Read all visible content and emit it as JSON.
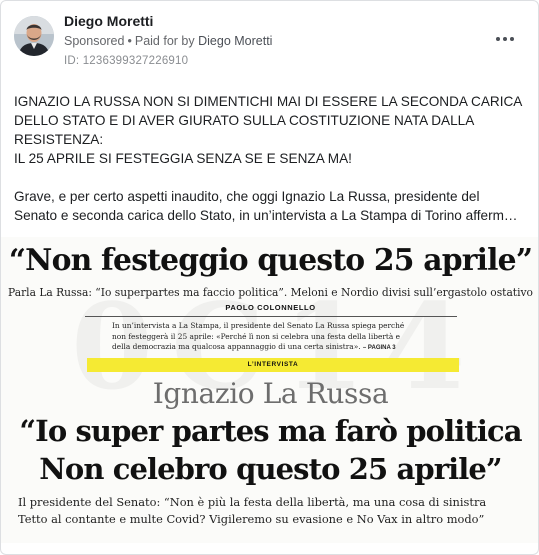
{
  "post": {
    "author_name": "Diego Moretti",
    "sponsored_label": "Sponsored",
    "separator": "•",
    "paid_for_by_label": "Paid for by",
    "payer": "Diego Moretti",
    "ad_id": "ID: 1236399327226910",
    "menu_icon": "more-options-icon"
  },
  "body": {
    "lines_upper": [
      "IGNAZIO LA RUSSA NON SI DIMENTICHI MAI DI ESSERE LA SECONDA CARICA",
      "DELLO STATO E DI AVER GIURATO SULLA COSTITUZIONE NATA DALLA",
      "RESISTENZA:",
      "IL 25 APRILE SI FESTEGGIA SENZA SE E SENZA MA!"
    ],
    "para2_line1": "Grave, e per certo aspetti inaudito, che oggi Ignazio La Russa, presidente del",
    "para2_line2": "Senato e seconda carica dello Stato, in un’intervista a La Stampa di Torino afferm…"
  },
  "clipping": {
    "headline": "“Non festeggio questo 25 aprile”",
    "subhead": "Parla La Russa: “Io superpartes ma faccio politica”. Meloni e Nordio divisi sull’ergastolo ostativo",
    "byline": "PAOLO COLONNELLO",
    "intro_lines": [
      "In un’intervista a La Stampa, il presidente del Senato La Russa spiega perché",
      "non festeggerà il 25 aprile: «Perché lì non si celebra una festa della libertà e",
      "della democrazia ma qualcosa appannaggio di una certa sinistra». "
    ],
    "intro_ref": "– PAGINA 3",
    "band_label": "L’INTERVISTA",
    "name_heading": "Ignazio La Russa",
    "quote_line1": "“Io super partes ma farò politica",
    "quote_line2": "Non celebro questo 25 aprile”",
    "deck_line1": "Il presidente del Senato: “Non è più la festa della libertà, ma una cosa di sinistra",
    "deck_line2": "Tetto al contante e multe Covid? Vigileremo su evasione e No Vax in altro modo”",
    "watermark": "0C14",
    "colors": {
      "highlight_band": "#f5ea33",
      "name_heading": "#6d6d6d"
    }
  }
}
